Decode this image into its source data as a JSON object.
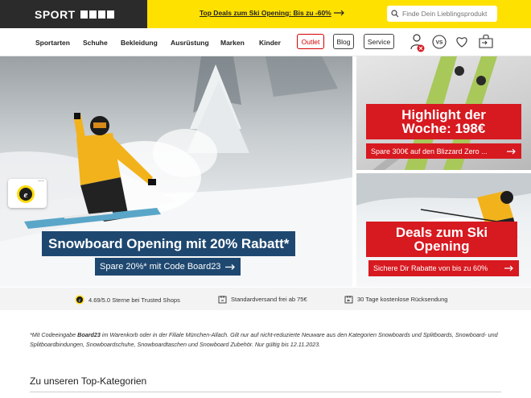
{
  "header": {
    "logo_word": "SPORT",
    "promo_text": "Top Deals zum Ski Opening: Bis zu -60%",
    "search_placeholder": "Finde Dein Lieblingsprodukt"
  },
  "nav": {
    "items": [
      "Sportarten",
      "Schuhe",
      "Bekleidung",
      "Ausrüstung",
      "Marken",
      "Kinder"
    ],
    "pills": [
      "Outlet",
      "Blog",
      "Service"
    ],
    "vs_label": "VS"
  },
  "hero": {
    "main_title": "Snowboard Opening mit 20% Rabatt*",
    "main_cta": "Spare 20%* mit Code Board23",
    "top_title_line1": "Highlight der",
    "top_title_line2": "Woche: 198€",
    "top_cta": "Spare 300€ auf den Blizzard Zero ...",
    "bottom_title_line1": "Deals zum Ski",
    "bottom_title_line2": "Opening",
    "bottom_cta": "Sichere Dir Rabatte von bis zu 60%",
    "badge_dots": "···"
  },
  "strip": {
    "rating": "4.69/5.0 Sterne bei Trusted Shops",
    "shipping": "Standardversand frei ab 75€",
    "returns": "30 Tage kostenlose Rücksendung"
  },
  "disclaimer": {
    "prefix": "*Mit Codeeingabe ",
    "code": "Board23",
    "rest": " im Warenkorb oder in der Filiale München-Allach. Gilt nur auf nicht-reduzierte Neuware aus den Kategorien Snowboards und Splitboards, Snowboard- und Splitboardbindungen, Snowboardschuhe, Snowboardtaschen und Snowboard Zubehör. Nur gültig bis 12.11.2023."
  },
  "section": {
    "title": "Zu unseren Top-Kategorien"
  },
  "colors": {
    "brand_yellow": "#ffe100",
    "logo_dark": "#2b2b2b",
    "promo_red": "#d71920",
    "promo_blue": "#1e4870"
  }
}
